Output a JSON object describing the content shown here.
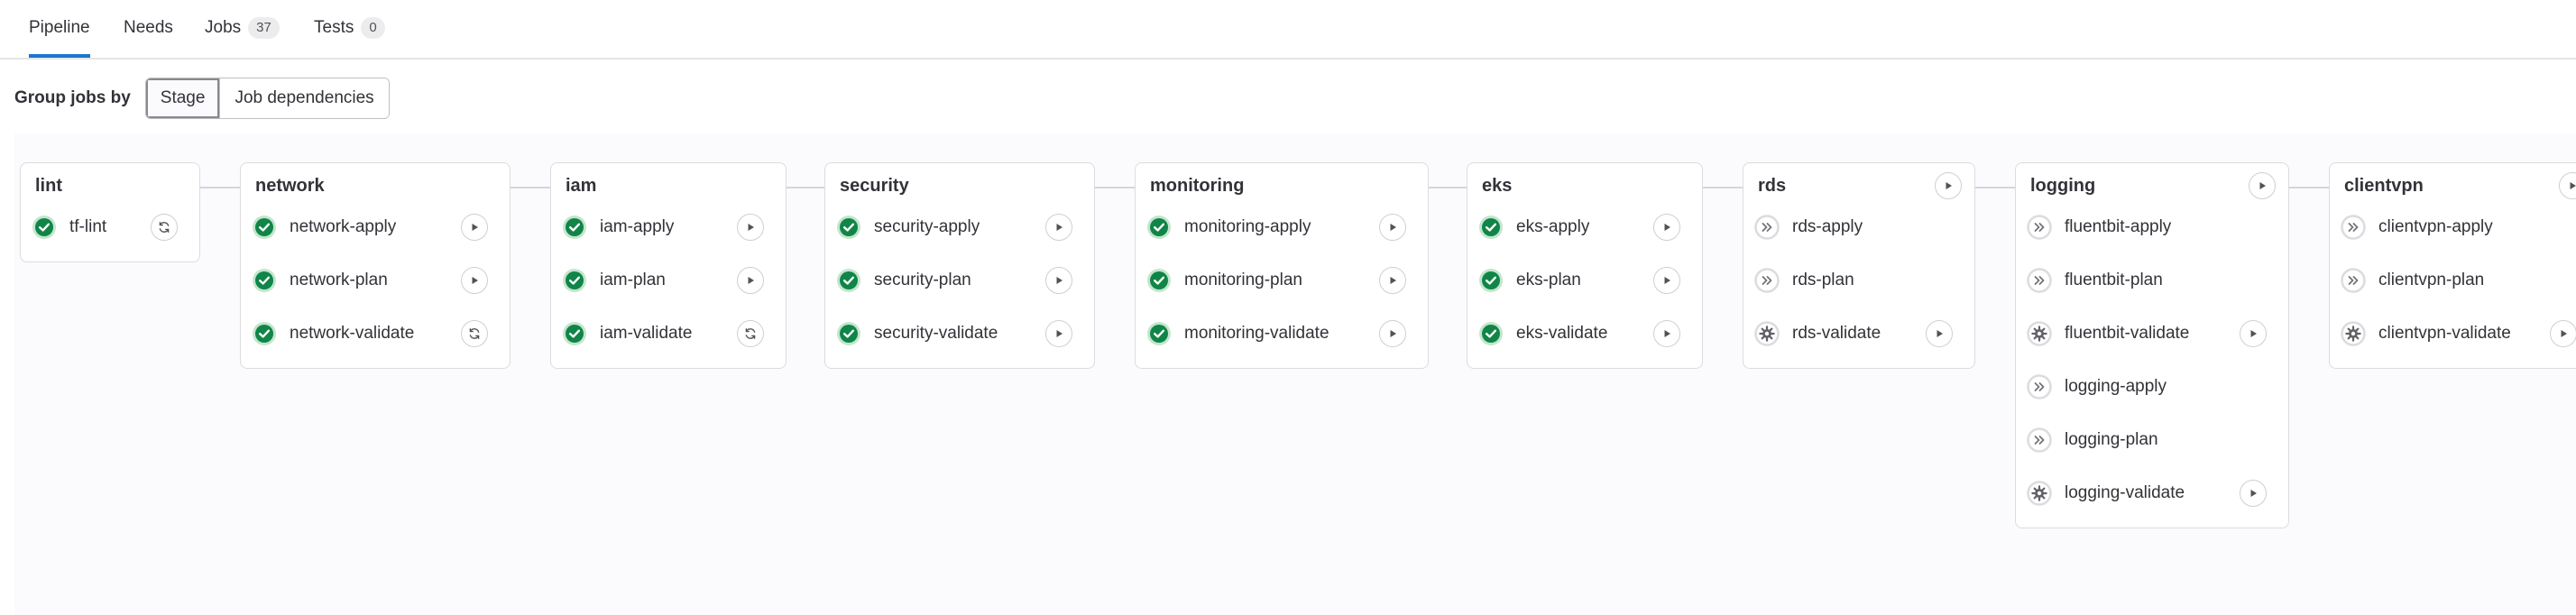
{
  "tabs": [
    {
      "label": "Pipeline"
    },
    {
      "label": "Needs"
    },
    {
      "label": "Jobs",
      "count": "37"
    },
    {
      "label": "Tests",
      "count": "0"
    }
  ],
  "group_by": {
    "label": "Group jobs by",
    "options": [
      "Stage",
      "Job dependencies"
    ],
    "selected": "Stage"
  },
  "colors": {
    "success": "#108548",
    "accent": "#1f75cb",
    "skipped": "#89888d"
  },
  "stages": [
    {
      "name": "lint",
      "stage_action": null,
      "jobs": [
        {
          "name": "tf-lint",
          "status": "success",
          "action": "retry"
        }
      ]
    },
    {
      "name": "network",
      "stage_action": null,
      "jobs": [
        {
          "name": "network-apply",
          "status": "success",
          "action": "play"
        },
        {
          "name": "network-plan",
          "status": "success",
          "action": "play"
        },
        {
          "name": "network-validate",
          "status": "success",
          "action": "retry"
        }
      ]
    },
    {
      "name": "iam",
      "stage_action": null,
      "jobs": [
        {
          "name": "iam-apply",
          "status": "success",
          "action": "play"
        },
        {
          "name": "iam-plan",
          "status": "success",
          "action": "play"
        },
        {
          "name": "iam-validate",
          "status": "success",
          "action": "retry"
        }
      ]
    },
    {
      "name": "security",
      "stage_action": null,
      "jobs": [
        {
          "name": "security-apply",
          "status": "success",
          "action": "play"
        },
        {
          "name": "security-plan",
          "status": "success",
          "action": "play"
        },
        {
          "name": "security-validate",
          "status": "success",
          "action": "play"
        }
      ]
    },
    {
      "name": "monitoring",
      "stage_action": null,
      "jobs": [
        {
          "name": "monitoring-apply",
          "status": "success",
          "action": "play"
        },
        {
          "name": "monitoring-plan",
          "status": "success",
          "action": "play"
        },
        {
          "name": "monitoring-validate",
          "status": "success",
          "action": "play"
        }
      ]
    },
    {
      "name": "eks",
      "stage_action": null,
      "jobs": [
        {
          "name": "eks-apply",
          "status": "success",
          "action": "play"
        },
        {
          "name": "eks-plan",
          "status": "success",
          "action": "play"
        },
        {
          "name": "eks-validate",
          "status": "success",
          "action": "play"
        }
      ]
    },
    {
      "name": "rds",
      "stage_action": "play",
      "jobs": [
        {
          "name": "rds-apply",
          "status": "skipped",
          "action": null
        },
        {
          "name": "rds-plan",
          "status": "skipped",
          "action": null
        },
        {
          "name": "rds-validate",
          "status": "manual",
          "action": "play"
        }
      ]
    },
    {
      "name": "logging",
      "stage_action": "play",
      "jobs": [
        {
          "name": "fluentbit-apply",
          "status": "skipped",
          "action": null
        },
        {
          "name": "fluentbit-plan",
          "status": "skipped",
          "action": null
        },
        {
          "name": "fluentbit-validate",
          "status": "manual",
          "action": "play"
        },
        {
          "name": "logging-apply",
          "status": "skipped",
          "action": null
        },
        {
          "name": "logging-plan",
          "status": "skipped",
          "action": null
        },
        {
          "name": "logging-validate",
          "status": "manual",
          "action": "play"
        }
      ]
    },
    {
      "name": "clientvpn",
      "stage_action": "play",
      "jobs": [
        {
          "name": "clientvpn-apply",
          "status": "skipped",
          "action": null
        },
        {
          "name": "clientvpn-plan",
          "status": "skipped",
          "action": null
        },
        {
          "name": "clientvpn-validate",
          "status": "manual",
          "action": "play"
        }
      ]
    }
  ]
}
